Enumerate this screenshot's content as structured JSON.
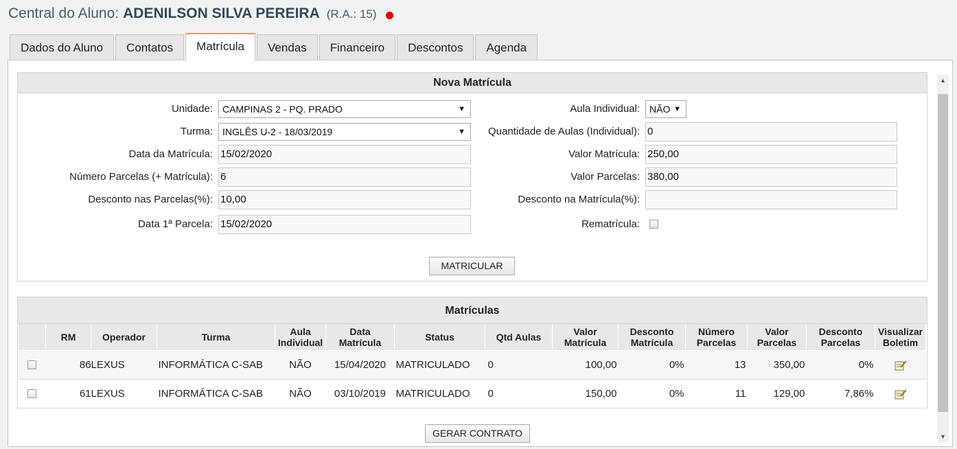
{
  "header": {
    "prefix": "Central do Aluno:",
    "student_name": "ADENILSON SILVA PEREIRA",
    "ra": "(R.A.: 15)",
    "status_color": "#e00000"
  },
  "tabs": [
    {
      "label": "Dados do Aluno"
    },
    {
      "label": "Contatos"
    },
    {
      "label": "Matrícula",
      "active": true
    },
    {
      "label": "Vendas"
    },
    {
      "label": "Financeiro"
    },
    {
      "label": "Descontos"
    },
    {
      "label": "Agenda"
    }
  ],
  "form": {
    "title": "Nova Matrícula",
    "unidade": {
      "label": "Unidade:",
      "value": "CAMPINAS 2 - PQ. PRADO"
    },
    "turma": {
      "label": "Turma:",
      "value": "INGLÊS U-2 - 18/03/2019"
    },
    "data_matricula": {
      "label": "Data da Matrícula:",
      "value": "15/02/2020"
    },
    "numero_parcelas": {
      "label": "Número Parcelas (+ Matrícula):",
      "value": "6"
    },
    "desconto_parcelas": {
      "label": "Desconto nas Parcelas(%):",
      "value": "10,00"
    },
    "data_1a_parcela": {
      "label": "Data 1ª Parcela:",
      "value": "15/02/2020"
    },
    "aula_individual": {
      "label": "Aula Individual:",
      "value": "NÃO"
    },
    "qtd_aulas": {
      "label": "Quantidade de Aulas (Individual):",
      "value": "0"
    },
    "valor_matricula": {
      "label": "Valor Matrícula:",
      "value": "250,00"
    },
    "valor_parcelas": {
      "label": "Valor Parcelas:",
      "value": "380,00"
    },
    "desconto_matricula": {
      "label": "Desconto na Matrícula(%):",
      "value": ""
    },
    "rematricula": {
      "label": "Rematrícula:"
    },
    "submit_label": "MATRICULAR"
  },
  "matriculas": {
    "title": "Matrículas",
    "columns": [
      "RM",
      "Operador",
      "Turma",
      "Aula Individual",
      "Data Matrícula",
      "Status",
      "Qtd Aulas",
      "Valor Matrícula",
      "Desconto Matrícula",
      "Número Parcelas",
      "Valor Parcelas",
      "Desconto Parcelas",
      "Visualizar Boletim"
    ],
    "rows": [
      {
        "rm": "86",
        "operador": "LEXUS",
        "turma": "INFORMÁTICA C-SAB",
        "aula_individual": "NÃO",
        "data": "15/04/2020",
        "status": "MATRICULADO",
        "qtd_aulas": "0",
        "valor_matricula": "100,00",
        "desconto_matricula": "0%",
        "numero_parcelas": "13",
        "valor_parcelas": "350,00",
        "desconto_parcelas": "0%"
      },
      {
        "rm": "61",
        "operador": "LEXUS",
        "turma": "INFORMÁTICA C-SAB",
        "aula_individual": "NÃO",
        "data": "03/10/2019",
        "status": "MATRICULADO",
        "qtd_aulas": "0",
        "valor_matricula": "150,00",
        "desconto_matricula": "0%",
        "numero_parcelas": "11",
        "valor_parcelas": "129,00",
        "desconto_parcelas": "7,86%"
      }
    ],
    "gerar_contrato_label": "GERAR CONTRATO"
  }
}
